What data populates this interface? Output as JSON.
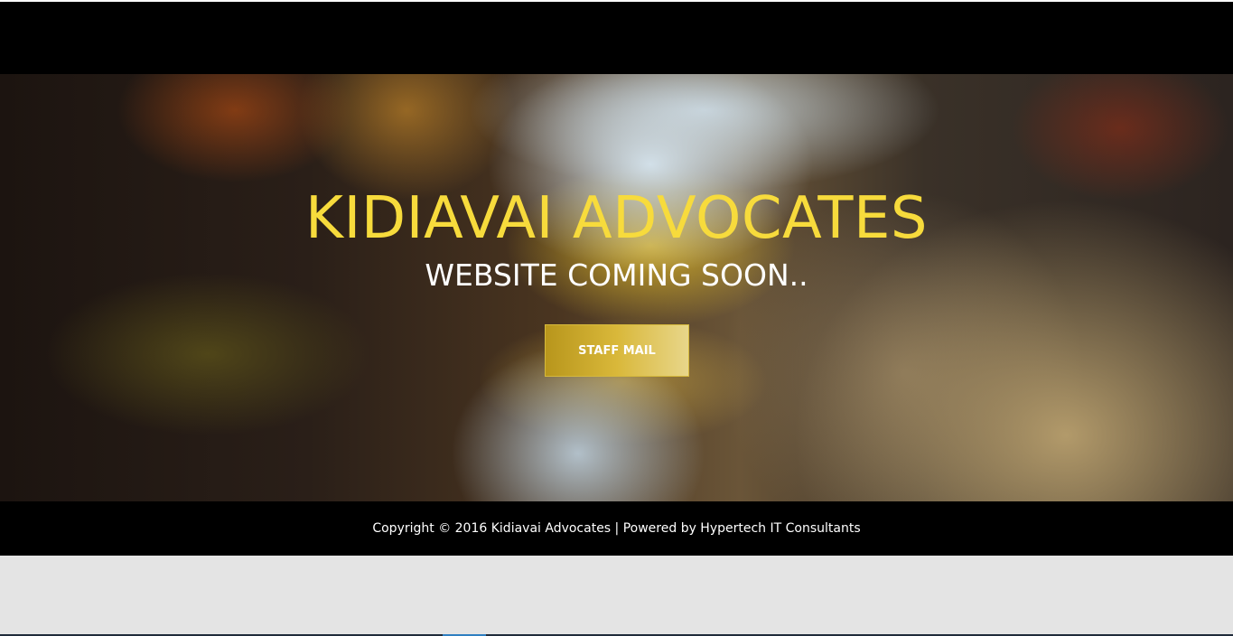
{
  "hero": {
    "title": "KIDIAVAI ADVOCATES",
    "subtitle": "WEBSITE COMING SOON..",
    "staff_mail_label": "STAFF MAIL"
  },
  "footer": {
    "copyright": "Copyright © 2016 Kidiavai Advocates | Powered by Hypertech IT Consultants"
  },
  "colors": {
    "title": "#f7db3c",
    "button_accent": "#d9b83a",
    "bars": "#000000",
    "page_background": "#e4e4e4"
  }
}
